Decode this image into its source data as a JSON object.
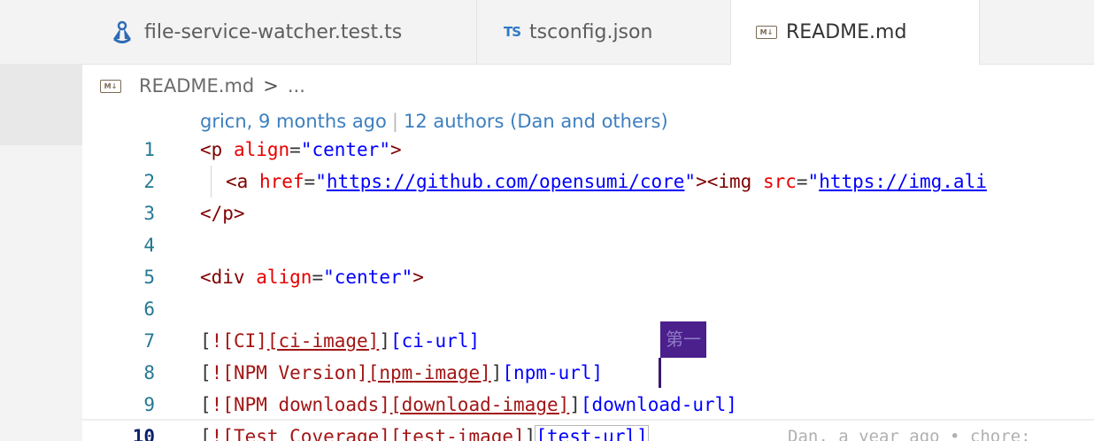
{
  "tabs": [
    {
      "label": "file-service-watcher.test.ts",
      "icon": "jest-test-icon",
      "active": false
    },
    {
      "label": "tsconfig.json",
      "icon": "typescript-icon",
      "icon_text": "TS",
      "active": false
    },
    {
      "label": "README.md",
      "icon": "markdown-icon",
      "icon_text": "M↓",
      "active": true
    }
  ],
  "breadcrumb": {
    "icon": "markdown-icon",
    "icon_text": "M↓",
    "file": "README.md",
    "separator": ">",
    "more": "..."
  },
  "blame": {
    "author_time": "gricn, 9 months ago",
    "separator": "|",
    "authors": "12 authors (Dan and others)"
  },
  "lines": {
    "n1": "1",
    "n2": "2",
    "n3": "3",
    "n4": "4",
    "n5": "5",
    "n6": "6",
    "n7": "7",
    "n8": "8",
    "n9": "9",
    "n10": "10"
  },
  "code": {
    "l1": {
      "open": "<p",
      "attr": "align",
      "eq": "=",
      "val": "\"center\"",
      "close": ">"
    },
    "l2": {
      "open": "<a",
      "attr": "href",
      "eq": "=",
      "q1": "\"",
      "url": "https://github.com/opensumi/core",
      "q2": "\"",
      "mid": "><img",
      "attr2": "src",
      "eq2": "=",
      "q3": "\"",
      "url2": "https://img.ali"
    },
    "l3": {
      "text": "</p>"
    },
    "l5": {
      "open": "<div",
      "attr": "align",
      "eq": "=",
      "val": "\"center\"",
      "close": ">"
    },
    "l7": {
      "a": "[",
      "b": "![CI]",
      "c": "[ci-image]",
      "d": "]",
      "e": "[ci-url]"
    },
    "l8": {
      "a": "[",
      "b": "![NPM Version]",
      "c": "[npm-image]",
      "d": "]",
      "e": "[npm-url]"
    },
    "l9": {
      "a": "[",
      "b": "![NPM downloads]",
      "c": "[download-image]",
      "d": "]",
      "e": "[download-url]"
    },
    "l10": {
      "a": "[",
      "b": "![Test Coverage]",
      "c": "[test-image]",
      "d": "]",
      "e": "[test-url]"
    }
  },
  "ghost_blame": "Dan, a year ago • chore:",
  "ime_candidate": "第一"
}
